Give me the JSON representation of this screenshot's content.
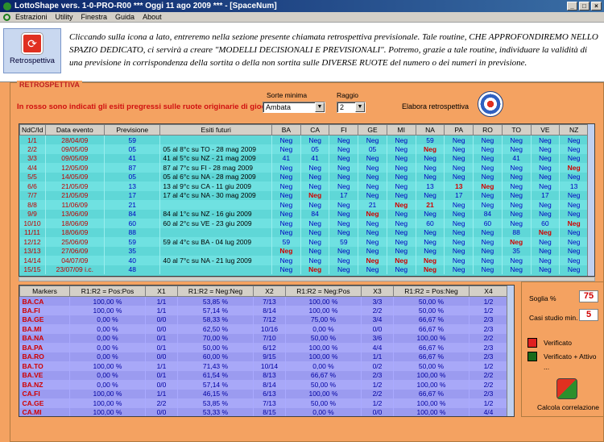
{
  "window": {
    "title": "LottoShape vers. 1-0-PRO-R00   ***   Oggi 11 ago 2009   ***   - [SpaceNum]"
  },
  "menu": [
    "Estrazioni",
    "Utility",
    "Finestra",
    "Guida",
    "About"
  ],
  "info": {
    "button_label": "Retrospettiva",
    "text": "Cliccando sulla icona a lato, entreremo nella sezione presente chiamata retrospettiva previsionale. Tale routine, CHE APPROFONDIREMO NELLO SPAZIO DEDICATO, ci servirà a creare \"MODELLI DECISIONALI E PREVISIONALI\". Potremo, grazie a tale routine, individuare la validità di una previsione in corrispondenza della sortita o della non sortita sulle DIVERSE RUOTE del numero o dei numeri in previsione."
  },
  "panel": {
    "title": "RETROSPETTIVA",
    "red_note": "In rosso sono indicati gli esiti pregressi sulle ruote originarie di gioco",
    "sorte_label": "Sorte minima",
    "sorte_value": "Ambata",
    "raggio_label": "Raggio",
    "raggio_value": "2",
    "elabora_label": "Elabora retrospettiva"
  },
  "grid1": {
    "headers": [
      "NdC/Id",
      "Data evento",
      "Previsione",
      "Esiti futuri",
      "BA",
      "CA",
      "FI",
      "GE",
      "MI",
      "NA",
      "PA",
      "RO",
      "TO",
      "VE",
      "NZ"
    ],
    "rows": [
      [
        "1/1",
        "28/04/09",
        "59",
        "",
        "Neg",
        "Neg",
        "Neg",
        "Neg",
        "Neg",
        "59",
        "Neg",
        "Neg",
        "Neg",
        "Neg",
        "Neg"
      ],
      [
        "2/2",
        "09/05/09",
        "05",
        "05 al 8°c su TO - 28 mag 2009",
        "Neg",
        "05",
        "Neg",
        "05",
        "Neg",
        "Neg",
        "Neg",
        "Neg",
        "Neg",
        "Neg",
        "Neg"
      ],
      [
        "3/3",
        "09/05/09",
        "41",
        "41 al 5°c su NZ - 21 mag 2009",
        "41",
        "41",
        "Neg",
        "Neg",
        "Neg",
        "Neg",
        "Neg",
        "Neg",
        "41",
        "Neg",
        "Neg"
      ],
      [
        "4/4",
        "12/05/09",
        "87",
        "87 al 7°c su FI - 28 mag 2009",
        "Neg",
        "Neg",
        "Neg",
        "Neg",
        "Neg",
        "Neg",
        "Neg",
        "Neg",
        "Neg",
        "Neg",
        "Neg"
      ],
      [
        "5/5",
        "14/05/09",
        "05",
        "05 al 6°c su NA - 28 mag 2009",
        "Neg",
        "Neg",
        "Neg",
        "Neg",
        "Neg",
        "Neg",
        "Neg",
        "Neg",
        "Neg",
        "Neg",
        "Neg"
      ],
      [
        "6/6",
        "21/05/09",
        "13",
        "13 al 9°c su CA - 11 giu 2009",
        "Neg",
        "Neg",
        "Neg",
        "Neg",
        "Neg",
        "13",
        "13",
        "Neg",
        "Neg",
        "Neg",
        "13"
      ],
      [
        "7/7",
        "21/05/09",
        "17",
        "17 al 4°c su NA - 30 mag 2009",
        "Neg",
        "Neg",
        "17",
        "Neg",
        "Neg",
        "Neg",
        "17",
        "Neg",
        "Neg",
        "17",
        "Neg"
      ],
      [
        "8/8",
        "11/06/09",
        "21",
        "",
        "Neg",
        "Neg",
        "Neg",
        "21",
        "Neg",
        "21",
        "Neg",
        "Neg",
        "Neg",
        "Neg",
        "Neg"
      ],
      [
        "9/9",
        "13/06/09",
        "84",
        "84 al 1°c su NZ - 16 giu 2009",
        "Neg",
        "84",
        "Neg",
        "Neg",
        "Neg",
        "Neg",
        "Neg",
        "84",
        "Neg",
        "Neg",
        "Neg"
      ],
      [
        "10/10",
        "18/06/09",
        "60",
        "60 al 2°c su VE - 23 giu 2009",
        "Neg",
        "Neg",
        "Neg",
        "Neg",
        "Neg",
        "60",
        "Neg",
        "60",
        "Neg",
        "60",
        "Neg"
      ],
      [
        "11/11",
        "18/06/09",
        "88",
        "",
        "Neg",
        "Neg",
        "Neg",
        "Neg",
        "Neg",
        "Neg",
        "Neg",
        "Neg",
        "88",
        "Neg",
        "Neg"
      ],
      [
        "12/12",
        "25/06/09",
        "59",
        "59 al 4°c su BA - 04 lug 2009",
        "59",
        "Neg",
        "59",
        "Neg",
        "Neg",
        "Neg",
        "Neg",
        "Neg",
        "Neg",
        "Neg",
        "Neg"
      ],
      [
        "13/13",
        "27/06/09",
        "35",
        "",
        "Neg",
        "Neg",
        "Neg",
        "Neg",
        "Neg",
        "Neg",
        "Neg",
        "Neg",
        "35",
        "Neg",
        "Neg"
      ],
      [
        "14/14",
        "04/07/09",
        "40",
        "40 al 7°c su NA - 21 lug 2009",
        "Neg",
        "Neg",
        "Neg",
        "Neg",
        "Neg",
        "Neg",
        "Neg",
        "Neg",
        "Neg",
        "Neg",
        "Neg"
      ],
      [
        "15/15",
        "23/07/09 i.c.",
        "48",
        "",
        "Neg",
        "Neg",
        "Neg",
        "Neg",
        "Neg",
        "Neg",
        "Neg",
        "Neg",
        "Neg",
        "Neg",
        "Neg"
      ]
    ],
    "hits": [
      [
        1,
        9
      ],
      [
        3,
        14
      ],
      [
        5,
        10
      ],
      [
        5,
        11
      ],
      [
        6,
        5
      ],
      [
        7,
        8
      ],
      [
        7,
        9
      ],
      [
        8,
        7
      ],
      [
        9,
        14
      ],
      [
        10,
        13
      ],
      [
        11,
        12
      ],
      [
        12,
        4
      ],
      [
        13,
        7
      ],
      [
        13,
        8
      ],
      [
        13,
        9
      ],
      [
        14,
        5
      ],
      [
        14,
        9
      ]
    ]
  },
  "grid2": {
    "headers": [
      "Markers",
      "R1:R2 = Pos:Pos",
      "X1",
      "R1:R2 = Neg:Neg",
      "X2",
      "R1:R2 = Neg:Pos",
      "X3",
      "R1:R2 = Pos:Neg",
      "X4"
    ],
    "rows": [
      [
        "BA.CA",
        "100,00 %",
        "1/1",
        "53,85 %",
        "7/13",
        "100,00 %",
        "3/3",
        "50,00 %",
        "1/2"
      ],
      [
        "BA.FI",
        "100,00 %",
        "1/1",
        "57,14 %",
        "8/14",
        "100,00 %",
        "2/2",
        "50,00 %",
        "1/2"
      ],
      [
        "BA.GE",
        "0,00 %",
        "0/0",
        "58,33 %",
        "7/12",
        "75,00 %",
        "3/4",
        "66,67 %",
        "2/3"
      ],
      [
        "BA.MI",
        "0,00 %",
        "0/0",
        "62,50 %",
        "10/16",
        "0,00 %",
        "0/0",
        "66,67 %",
        "2/3"
      ],
      [
        "BA.NA",
        "0,00 %",
        "0/1",
        "70,00 %",
        "7/10",
        "50,00 %",
        "3/6",
        "100,00 %",
        "2/2"
      ],
      [
        "BA.PA",
        "0,00 %",
        "0/1",
        "50,00 %",
        "6/12",
        "100,00 %",
        "4/4",
        "66,67 %",
        "2/3"
      ],
      [
        "BA.RO",
        "0,00 %",
        "0/0",
        "60,00 %",
        "9/15",
        "100,00 %",
        "1/1",
        "66,67 %",
        "2/3"
      ],
      [
        "BA.TO",
        "100,00 %",
        "1/1",
        "71,43 %",
        "10/14",
        "0,00 %",
        "0/2",
        "50,00 %",
        "1/2"
      ],
      [
        "BA.VE",
        "0,00 %",
        "0/1",
        "61,54 %",
        "8/13",
        "66,67 %",
        "2/3",
        "100,00 %",
        "2/2"
      ],
      [
        "BA.NZ",
        "0,00 %",
        "0/0",
        "57,14 %",
        "8/14",
        "50,00 %",
        "1/2",
        "100,00 %",
        "2/2"
      ],
      [
        "CA.FI",
        "100,00 %",
        "1/1",
        "46,15 %",
        "6/13",
        "100,00 %",
        "2/2",
        "66,67 %",
        "2/3"
      ],
      [
        "CA.GE",
        "100,00 %",
        "2/2",
        "53,85 %",
        "7/13",
        "50,00 %",
        "1/2",
        "100,00 %",
        "1/2"
      ],
      [
        "CA.MI",
        "100,00 %",
        "0/0",
        "53,33 %",
        "8/15",
        "0,00 %",
        "0/0",
        "100,00 %",
        "4/4"
      ]
    ]
  },
  "side": {
    "soglia_label": "Soglia %",
    "soglia_value": "75",
    "casi_label": "Casi studio min.",
    "casi_value": "5",
    "verificato": "Verificato",
    "verificato_attivo": "Verificato + Attivo",
    "dots": "...",
    "calcola": "Calcola correlazione"
  },
  "colors": {
    "verificato": "#e02020",
    "verificato_attivo": "#1a6a1a"
  }
}
